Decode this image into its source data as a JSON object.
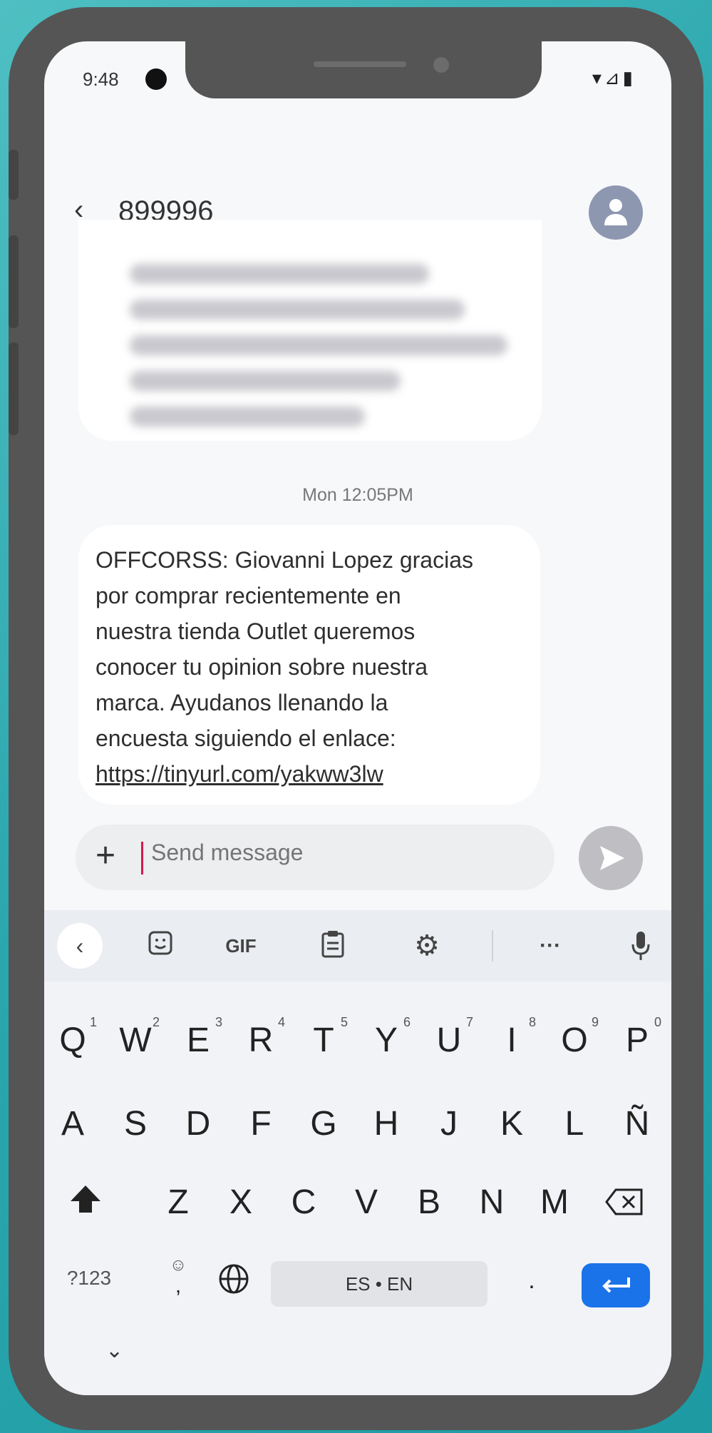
{
  "status_bar": {
    "time": "9:48",
    "right_icons": "▾⊿▮"
  },
  "app_bar": {
    "back_icon": "back-arrow-icon",
    "contact": "899996",
    "avatar_icon": "person-icon"
  },
  "thread": {
    "timestamp": "Mon 12:05PM",
    "message_lines": [
      "OFFCORSS: Giovanni Lopez gracias",
      "por comprar recientemente en",
      "nuestra tienda Outlet queremos",
      "conocer tu opinion sobre nuestra",
      "marca. Ayudanos llenando la",
      "encuesta siguiendo el enlace:"
    ],
    "message_link": "https://tinyurl.com/yakww3lw"
  },
  "composer": {
    "plus": "+",
    "placeholder": "Send message"
  },
  "keyboard": {
    "toolbar": {
      "gif": "GIF",
      "more": "···"
    },
    "row1": [
      "Q",
      "W",
      "E",
      "R",
      "T",
      "Y",
      "U",
      "I",
      "O",
      "P"
    ],
    "row1_nums": [
      "1",
      "2",
      "3",
      "4",
      "5",
      "6",
      "7",
      "8",
      "9",
      "0"
    ],
    "row2": [
      "A",
      "S",
      "D",
      "F",
      "G",
      "H",
      "J",
      "K",
      "L",
      "Ñ"
    ],
    "row3": [
      "Z",
      "X",
      "C",
      "V",
      "B",
      "N",
      "M"
    ],
    "symbols_key": "?123",
    "space_label": "ES • EN",
    "period": ".",
    "comma": ","
  },
  "colors": {
    "accent": "#1a73e8",
    "caret": "#d11a4e",
    "background": "#2aa6ad"
  }
}
